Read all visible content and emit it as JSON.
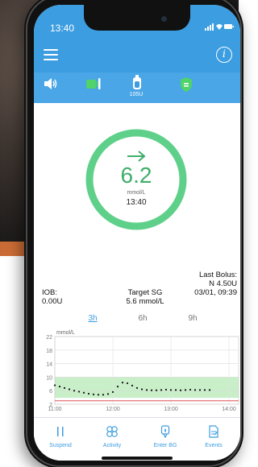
{
  "status": {
    "time": "13:40",
    "icons": "▐▐ ▿ ▬"
  },
  "reservoir": {
    "label": "105U"
  },
  "glucose": {
    "value": "6.2",
    "unit": "mmol/L",
    "time": "13:40",
    "trend": "arrow-right"
  },
  "iob": {
    "label": "IOB:",
    "value": "0.00U"
  },
  "target": {
    "label": "Target SG",
    "value": "5.6 mmol/L"
  },
  "last_bolus": {
    "label": "Last Bolus:",
    "value": "N 4.50U",
    "time": "03/01, 09:39"
  },
  "tabs": [
    {
      "label": "3h",
      "active": true
    },
    {
      "label": "6h",
      "active": false
    },
    {
      "label": "9h",
      "active": false
    }
  ],
  "nav": [
    {
      "label": "Suspend",
      "icon": "pause-icon"
    },
    {
      "label": "Activity",
      "icon": "activity-icon"
    },
    {
      "label": "Enter BG",
      "icon": "blood-drop-icon"
    },
    {
      "label": "Events",
      "icon": "events-icon"
    }
  ],
  "colors": {
    "accent": "#3c9de0",
    "glucose": "#3fae6a",
    "target_band": "#c8efc8",
    "low_line": "#e05050"
  },
  "chart_data": {
    "type": "line",
    "ylabel": "mmol/L",
    "yticks": [
      2,
      6,
      10,
      14,
      18,
      22
    ],
    "ylim": [
      2,
      22
    ],
    "xticks": [
      "11:00",
      "12:00",
      "13:00",
      "14:00"
    ],
    "x_range": [
      "11:00",
      "14:10"
    ],
    "target_range": [
      3.9,
      10
    ],
    "low_threshold": 3.0,
    "series": [
      {
        "x": [
          "11:00",
          "11:05",
          "11:10",
          "11:15",
          "11:20",
          "11:25",
          "11:30",
          "11:35",
          "11:40",
          "11:45",
          "11:50",
          "11:55",
          "12:00",
          "12:05",
          "12:10",
          "12:15",
          "12:20",
          "12:25",
          "12:30",
          "12:35",
          "12:40",
          "12:45",
          "12:50",
          "12:55",
          "13:00",
          "13:05",
          "13:10",
          "13:15",
          "13:20",
          "13:25",
          "13:30",
          "13:35",
          "13:40"
        ],
        "y": [
          7.6,
          7.2,
          6.8,
          6.4,
          6.0,
          5.7,
          5.4,
          5.1,
          4.9,
          4.8,
          4.8,
          5.0,
          5.6,
          7.2,
          8.4,
          8.2,
          7.5,
          6.8,
          6.4,
          6.2,
          6.1,
          6.1,
          6.2,
          6.3,
          6.2,
          6.2,
          6.1,
          6.2,
          6.3,
          6.2,
          6.2,
          6.2,
          6.2
        ]
      }
    ]
  }
}
